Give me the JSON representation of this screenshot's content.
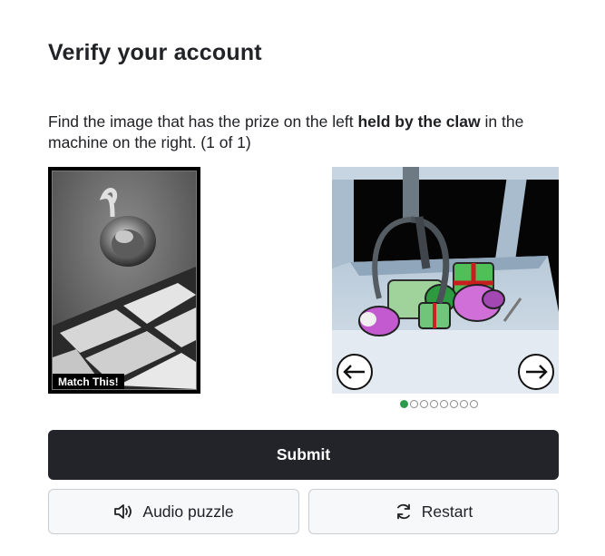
{
  "header": {
    "title": "Verify your account"
  },
  "instructions": {
    "before": "Find the image that has the prize on the left ",
    "emphasis": "held by the claw",
    "after": " in the machine on the right. (1 of 1)"
  },
  "reference": {
    "label": "Match This!"
  },
  "carousel": {
    "total_slides": 8,
    "active_index": 0,
    "prev_icon": "arrow-left-icon",
    "next_icon": "arrow-right-icon"
  },
  "actions": {
    "submit_label": "Submit",
    "audio_label": "Audio puzzle",
    "audio_icon": "speaker-icon",
    "restart_label": "Restart",
    "restart_icon": "refresh-icon"
  },
  "colors": {
    "primary": "#222429",
    "active_dot": "#2e9a4e",
    "secondary_bg": "#f7f8fa"
  }
}
